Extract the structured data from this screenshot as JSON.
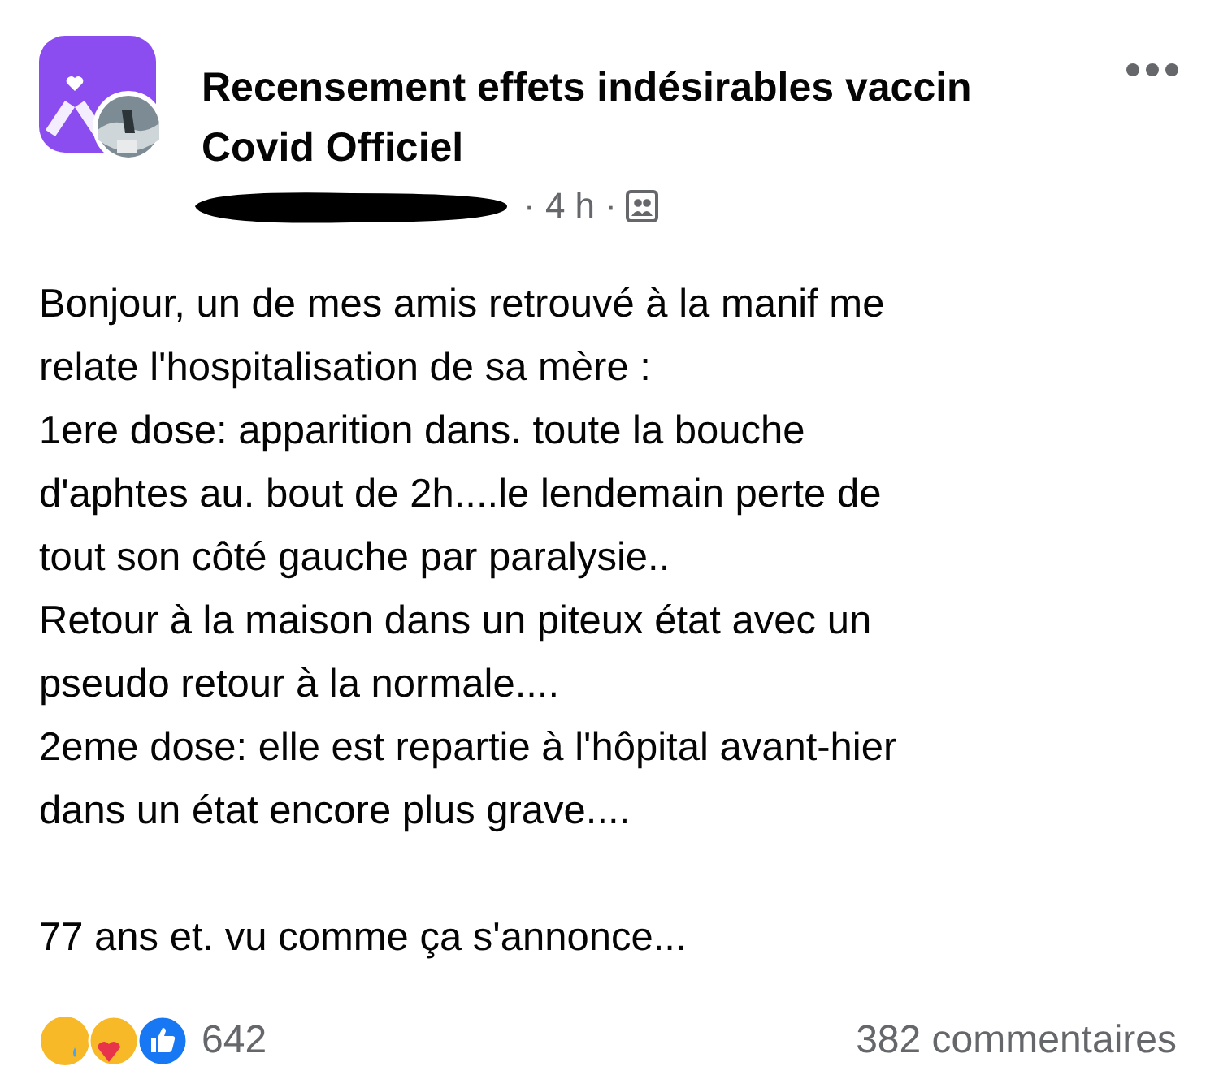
{
  "post": {
    "group_name": "Recensement effets indésirables vaccin Covid Officiel",
    "time": "· 4 h ·",
    "body": [
      [
        "Bonjour, un de mes amis retrouvé à la manif me",
        "relate l'hospitalisation de sa mère :",
        "1ere dose: apparition dans. toute la bouche",
        "d'aphtes au. bout de 2h....le lendemain perte de",
        "tout son côté gauche par paralysie..",
        "Retour à la maison dans un piteux état avec un",
        "pseudo retour à la normale....",
        "2eme dose: elle est repartie à l'hôpital avant-hier",
        "dans un état encore plus grave...."
      ],
      [
        "77 ans et. vu comme ça s'annonce..."
      ]
    ],
    "reaction_count": "642",
    "comments": "382 commentaires"
  }
}
